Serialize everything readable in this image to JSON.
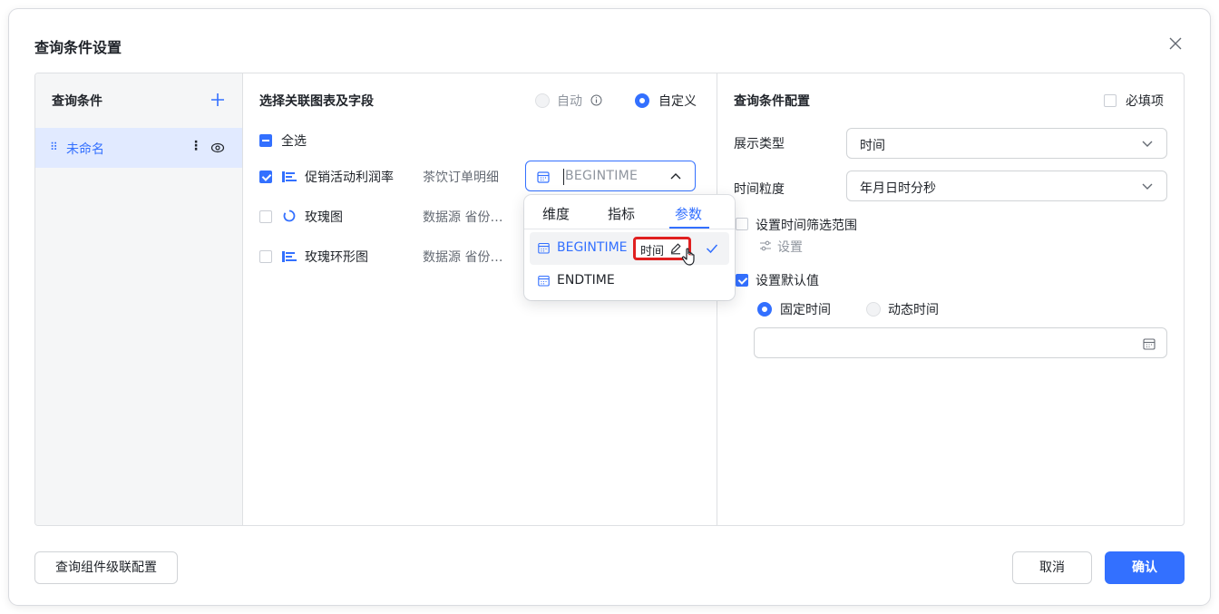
{
  "dialog": {
    "title": "查询条件设置"
  },
  "left": {
    "title": "查询条件",
    "items": [
      {
        "label": "未命名"
      }
    ]
  },
  "middle": {
    "title": "选择关联图表及字段",
    "mode_auto": "自动",
    "mode_custom": "自定义",
    "select_all": "全选",
    "charts": [
      {
        "name": "促销活动利润率",
        "source": "茶饮订单明细",
        "checked": true,
        "icon": "bar-chart-icon"
      },
      {
        "name": "玫瑰图",
        "source": "数据源 省份…",
        "checked": false,
        "icon": "rose-chart-icon"
      },
      {
        "name": "玫瑰环形图",
        "source": "数据源 省份…",
        "checked": false,
        "icon": "bar-chart-icon"
      }
    ],
    "field_select": {
      "placeholder": "BEGINTIME"
    },
    "dropdown": {
      "tabs": [
        "维度",
        "指标",
        "参数"
      ],
      "active_tab": "参数",
      "items": [
        {
          "label": "BEGINTIME",
          "tag": "时间",
          "selected": true
        },
        {
          "label": "ENDTIME",
          "selected": false
        }
      ]
    }
  },
  "right": {
    "title": "查询条件配置",
    "required_label": "必填项",
    "display_type_label": "展示类型",
    "display_type_value": "时间",
    "granularity_label": "时间粒度",
    "granularity_value": "年月日时分秒",
    "time_range_label": "设置时间筛选范围",
    "settings_label": "设置",
    "default_value_label": "设置默认值",
    "fixed_time_label": "固定时间",
    "dynamic_time_label": "动态时间",
    "date_value": ""
  },
  "footer": {
    "cascade_label": "查询组件级联配置",
    "cancel_label": "取消",
    "confirm_label": "确认"
  },
  "colors": {
    "accent": "#3370ff",
    "highlight": "#e02020"
  }
}
